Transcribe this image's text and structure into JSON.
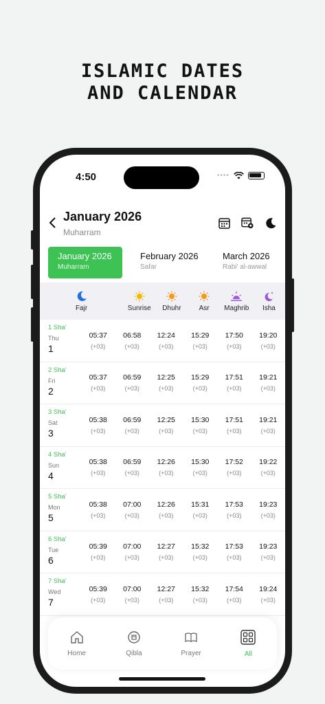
{
  "headline": {
    "line1": "ISLAMIC DATES",
    "line2": "AND CALENDAR"
  },
  "status": {
    "time": "4:50"
  },
  "header": {
    "title": "January 2026",
    "subtitle": "Muharram"
  },
  "months": [
    {
      "name": "January 2026",
      "hijri": "Muharram",
      "active": true
    },
    {
      "name": "February 2026",
      "hijri": "Safar",
      "active": false
    },
    {
      "name": "March 2026",
      "hijri": "Rabi' al-awwal",
      "active": false
    }
  ],
  "prayers": [
    {
      "label": "Fajr",
      "icon": "moon-icon",
      "color": "#1e6fe0"
    },
    {
      "label": "Sunrise",
      "icon": "sun-icon",
      "color": "#f5b800"
    },
    {
      "label": "Dhuhr",
      "icon": "sun-icon",
      "color": "#f29a1a"
    },
    {
      "label": "Asr",
      "icon": "sun-icon",
      "color": "#f29a1a"
    },
    {
      "label": "Maghrib",
      "icon": "sunset-icon",
      "color": "#9b59d9"
    },
    {
      "label": "Isha",
      "icon": "moon-stars-icon",
      "color": "#9b59d9"
    }
  ],
  "timezone": "(+03)",
  "rows": [
    {
      "hijri": "1 Sha'",
      "weekday": "Thu",
      "day": "1",
      "times": [
        "05:37",
        "06:58",
        "12:24",
        "15:29",
        "17:50",
        "19:20"
      ]
    },
    {
      "hijri": "2 Sha'",
      "weekday": "Fri",
      "day": "2",
      "times": [
        "05:37",
        "06:59",
        "12:25",
        "15:29",
        "17:51",
        "19:21"
      ]
    },
    {
      "hijri": "3 Sha'",
      "weekday": "Sat",
      "day": "3",
      "times": [
        "05:38",
        "06:59",
        "12:25",
        "15:30",
        "17:51",
        "19:21"
      ]
    },
    {
      "hijri": "4 Sha'",
      "weekday": "Sun",
      "day": "4",
      "times": [
        "05:38",
        "06:59",
        "12:26",
        "15:30",
        "17:52",
        "19:22"
      ]
    },
    {
      "hijri": "5 Sha'",
      "weekday": "Mon",
      "day": "5",
      "times": [
        "05:38",
        "07:00",
        "12:26",
        "15:31",
        "17:53",
        "19:23"
      ]
    },
    {
      "hijri": "6 Sha'",
      "weekday": "Tue",
      "day": "6",
      "times": [
        "05:39",
        "07:00",
        "12:27",
        "15:32",
        "17:53",
        "19:23"
      ]
    },
    {
      "hijri": "7 Sha'",
      "weekday": "Wed",
      "day": "7",
      "times": [
        "05:39",
        "07:00",
        "12:27",
        "15:32",
        "17:54",
        "19:24"
      ]
    }
  ],
  "nav": [
    {
      "label": "Home",
      "icon": "home-icon",
      "active": false
    },
    {
      "label": "Qibla",
      "icon": "compass-icon",
      "active": false
    },
    {
      "label": "Prayer",
      "icon": "book-icon",
      "active": false
    },
    {
      "label": "All",
      "icon": "grid-icon",
      "active": true
    }
  ],
  "colors": {
    "accent": "#3dc254",
    "header_bg": "#f1f0f5"
  }
}
